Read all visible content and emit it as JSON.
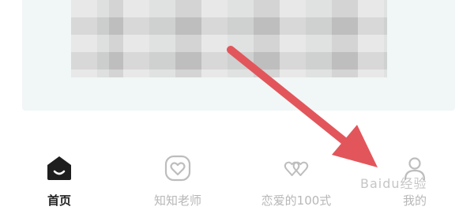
{
  "tabs": [
    {
      "label": "首页",
      "icon": "home-icon",
      "active": true
    },
    {
      "label": "知知老师",
      "icon": "heart-badge-icon",
      "active": false
    },
    {
      "label": "恋爱的100式",
      "icon": "double-heart-icon",
      "active": false
    },
    {
      "label": "我的",
      "icon": "profile-icon",
      "active": false
    }
  ],
  "colors": {
    "active_text": "#222222",
    "inactive_text": "#b7b7b7",
    "arrow": "#e2565b",
    "content_bg": "#f1f6f6"
  },
  "watermark": "Baidu经验"
}
